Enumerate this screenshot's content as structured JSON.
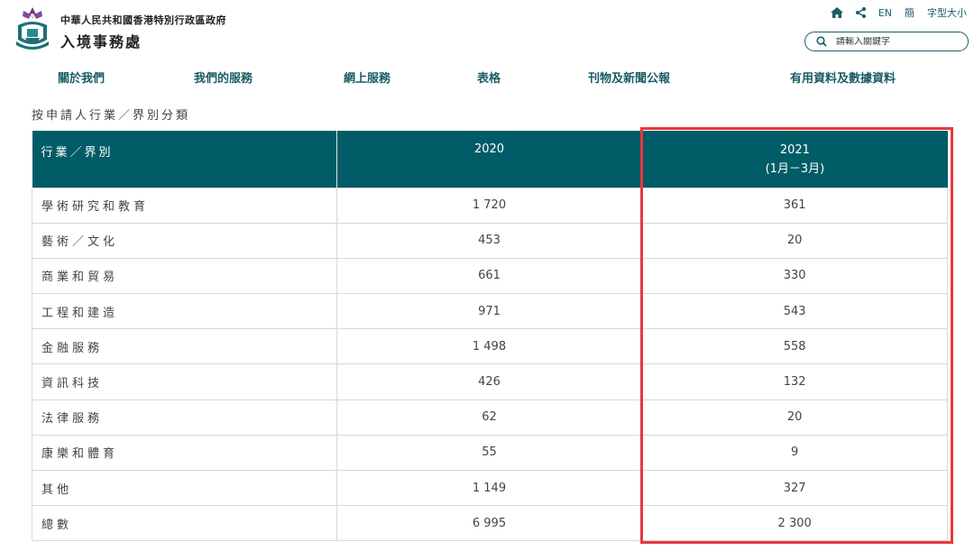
{
  "header": {
    "gov_title": "中華人民共和國香港特別行政區政府",
    "dept_title": "入境事務處",
    "home_icon": "home-icon",
    "share_icon": "share-icon",
    "lang_en": "EN",
    "lang_sc": "簡",
    "font_size": "字型大小"
  },
  "search": {
    "placeholder": "請輸入關鍵字",
    "icon": "search-icon"
  },
  "nav": {
    "items": [
      "關於我們",
      "我們的服務",
      "網上服務",
      "表格",
      "刊物及新聞公報",
      "有用資料及數據資料"
    ]
  },
  "subtitle": "按申請人行業／界別分類",
  "table": {
    "headers": [
      "行業／界別",
      "2020",
      "2021",
      "(1月－3月)"
    ],
    "rows": [
      [
        "學術研究和教育",
        "1 720",
        "361"
      ],
      [
        "藝術／文化",
        "453",
        "20"
      ],
      [
        "商業和貿易",
        "661",
        "330"
      ],
      [
        "工程和建造",
        "971",
        "543"
      ],
      [
        "金融服務",
        "1 498",
        "558"
      ],
      [
        "資訊科技",
        "426",
        "132"
      ],
      [
        "法律服務",
        "62",
        "20"
      ],
      [
        "康樂和體育",
        "55",
        "9"
      ],
      [
        "其他",
        "1 149",
        "327"
      ],
      [
        "總數",
        "6 995",
        "2 300"
      ]
    ]
  },
  "colors": {
    "brand": "#005c66",
    "link": "#1a5d66",
    "highlight": "#e8373d"
  }
}
